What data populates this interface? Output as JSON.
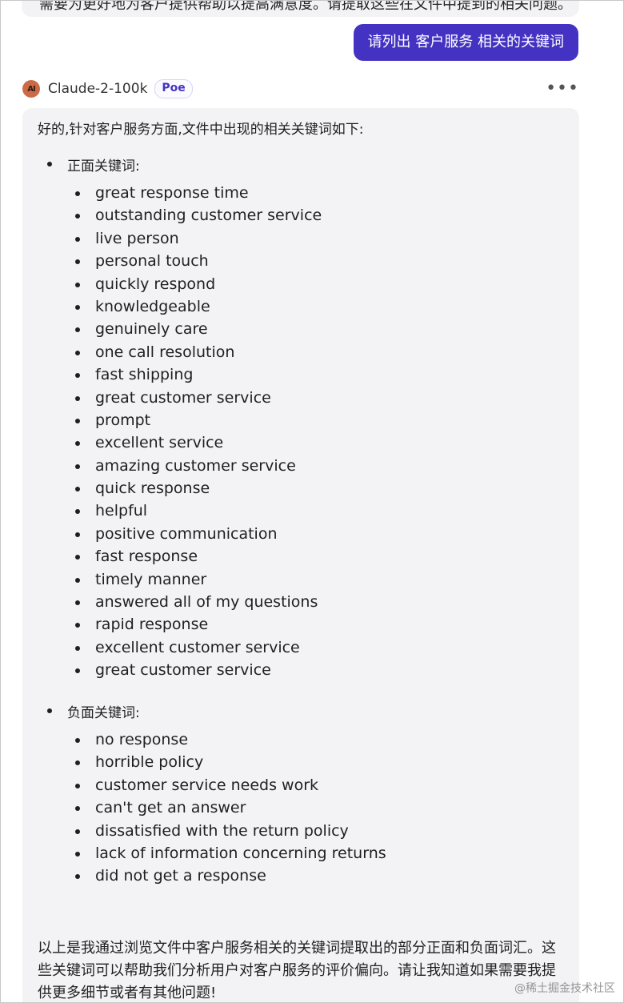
{
  "conversation": {
    "previous_message_partial": "需要为更好地为客户提供帮助以提高满意度。请提取这些在文件中提到的相关问题。",
    "user_message": "请列出 客户服务 相关的关键词"
  },
  "bot": {
    "avatar_label": "AI",
    "name": "Claude-2-100k",
    "badge": "Poe",
    "more_icon": "more-horizontal-icon"
  },
  "reply": {
    "intro": "好的,针对客户服务方面,文件中出现的相关关键词如下:",
    "positive_heading": "正面关键词:",
    "positive_keywords": [
      "great response time",
      "outstanding customer service",
      "live person",
      "personal touch",
      "quickly respond",
      "knowledgeable",
      "genuinely care",
      "one call resolution",
      "fast shipping",
      "great customer service",
      "prompt",
      "excellent service",
      "amazing customer service",
      "quick response",
      "helpful",
      "positive communication",
      "fast response",
      "timely manner",
      "answered all of my questions",
      "rapid response",
      "excellent customer service",
      "great customer service"
    ],
    "negative_heading": "负面关键词:",
    "negative_keywords": [
      "no response",
      "horrible policy",
      "customer service needs work",
      "can't get an answer",
      "dissatisfied with the return policy",
      "lack of information concerning returns",
      "did not get a response"
    ],
    "outro": "以上是我通过浏览文件中客户服务相关的关键词提取出的部分正面和负面词汇。这些关键词可以帮助我们分析用户对客户服务的评价偏向。请让我知道如果需要我提供更多细节或者有其他问题!"
  },
  "watermark": "@稀土掘金技术社区",
  "colors": {
    "accent": "#4433c2",
    "bubble_bg": "#f3f3f5",
    "avatar_bg": "#cc6a48"
  }
}
